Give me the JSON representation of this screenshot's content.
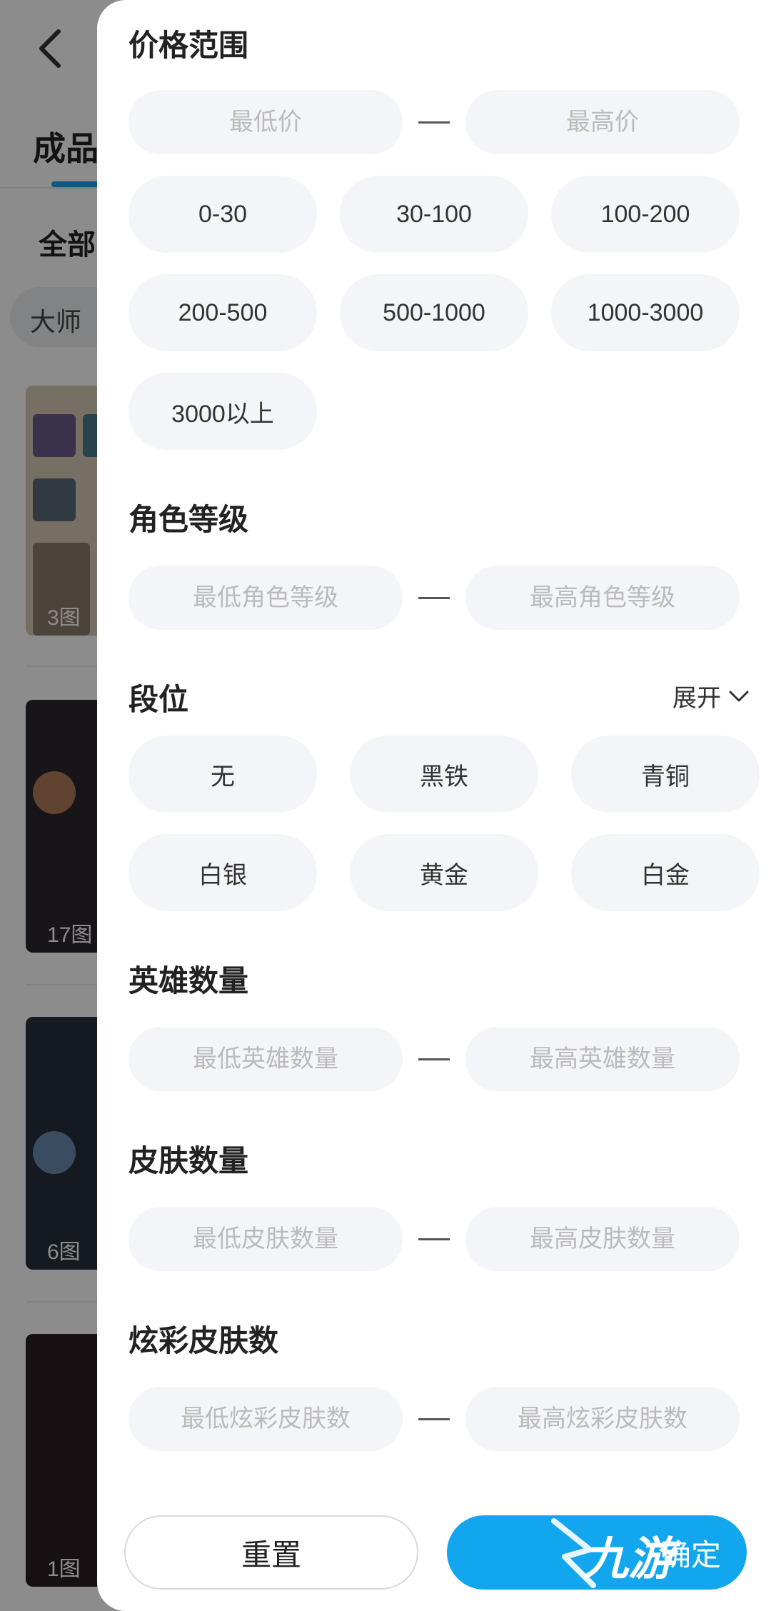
{
  "background": {
    "tab_label": "成品",
    "filter_label": "全部",
    "chip_label": "大师",
    "cards": [
      {
        "count": "3图"
      },
      {
        "count": "17图"
      },
      {
        "count": "6图"
      },
      {
        "count": "1图"
      }
    ]
  },
  "price": {
    "title": "价格范围",
    "min_placeholder": "最低价",
    "max_placeholder": "最高价",
    "options": [
      "0-30",
      "30-100",
      "100-200",
      "200-500",
      "500-1000",
      "1000-3000",
      "3000以上"
    ]
  },
  "level": {
    "title": "角色等级",
    "min_placeholder": "最低角色等级",
    "max_placeholder": "最高角色等级"
  },
  "rank": {
    "title": "段位",
    "expand_label": "展开",
    "options": [
      "无",
      "黑铁",
      "青铜",
      "白银",
      "黄金",
      "白金"
    ]
  },
  "heroes": {
    "title": "英雄数量",
    "min_placeholder": "最低英雄数量",
    "max_placeholder": "最高英雄数量"
  },
  "skins": {
    "title": "皮肤数量",
    "min_placeholder": "最低皮肤数量",
    "max_placeholder": "最高皮肤数量"
  },
  "chroma": {
    "title": "炫彩皮肤数",
    "min_placeholder": "最低炫彩皮肤数",
    "max_placeholder": "最高炫彩皮肤数"
  },
  "actions": {
    "reset_label": "重置",
    "confirm_label": "确定"
  },
  "watermark": "九游",
  "colors": {
    "accent": "#12a6ef",
    "chip_bg": "#f4f5f8",
    "overlay": "rgba(0,0,0,0.45)"
  }
}
